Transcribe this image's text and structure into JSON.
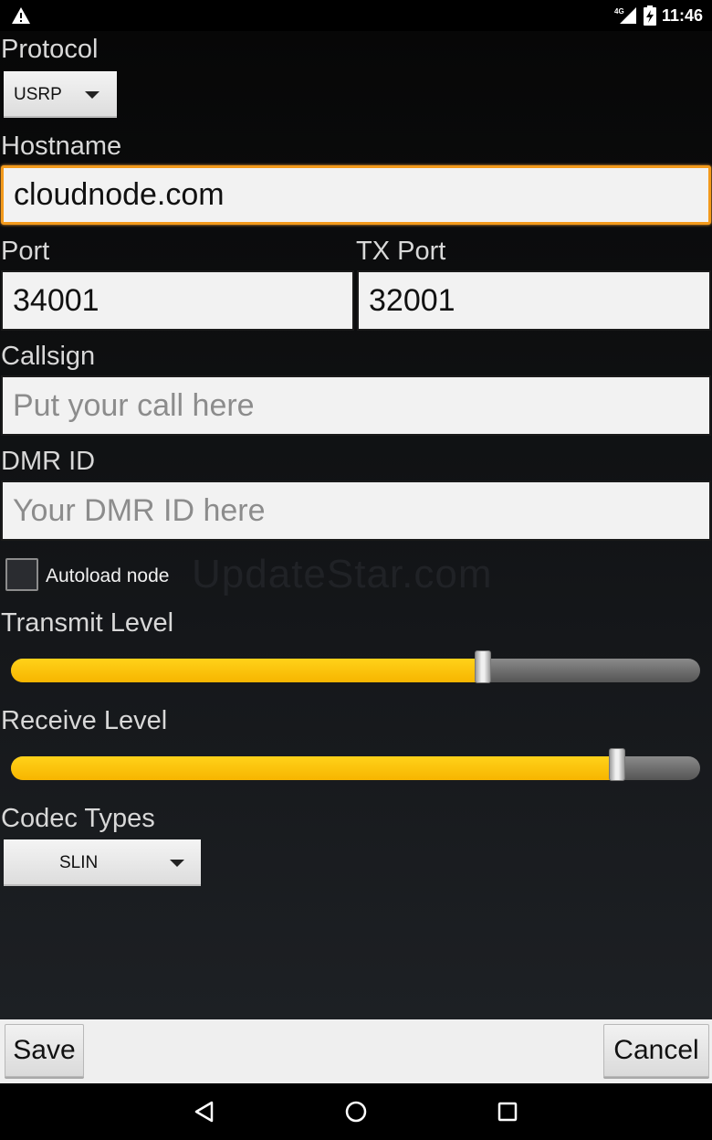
{
  "status_bar": {
    "time": "11:46",
    "network": "4G",
    "icons": [
      "warning-icon",
      "signal-icon",
      "battery-charging-icon"
    ]
  },
  "form": {
    "protocol": {
      "label": "Protocol",
      "value": "USRP"
    },
    "hostname": {
      "label": "Hostname",
      "value": "cloudnode.com"
    },
    "port": {
      "label": "Port",
      "value": "34001"
    },
    "tx_port": {
      "label": "TX Port",
      "value": "32001"
    },
    "callsign": {
      "label": "Callsign",
      "value": "",
      "placeholder": "Put your call here"
    },
    "dmr_id": {
      "label": "DMR ID",
      "value": "",
      "placeholder": "Your DMR ID here"
    },
    "autoload": {
      "label": "Autoload node",
      "checked": false
    },
    "transmit_level": {
      "label": "Transmit Level",
      "level": 0.685
    },
    "receive_level": {
      "label": "Receive Level",
      "level": 0.88
    },
    "codec": {
      "label": "Codec Types",
      "value": "SLIN"
    }
  },
  "watermark": "UpdateStar.com",
  "buttons": {
    "save": "Save",
    "cancel": "Cancel"
  },
  "nav": {
    "icons": [
      "back-icon",
      "home-icon",
      "recents-icon"
    ]
  },
  "colors": {
    "accent": "#f7b500",
    "focus": "#f39a1b"
  }
}
